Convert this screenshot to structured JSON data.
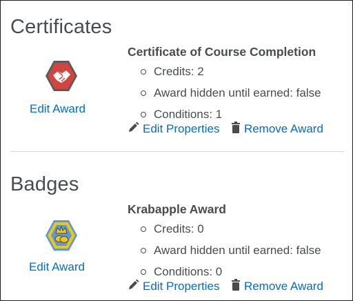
{
  "certificates": {
    "heading": "Certificates",
    "award": {
      "icon": "handshake-hexagon-icon",
      "edit_award_label": "Edit Award",
      "name": "Certificate of Course Completion",
      "properties": [
        "Credits: 2",
        "Award hidden until earned: false",
        "Conditions: 1"
      ],
      "edit_properties_label": "Edit Properties",
      "remove_award_label": "Remove Award"
    }
  },
  "badges": {
    "heading": "Badges",
    "award": {
      "icon": "crown-hexagon-icon",
      "edit_award_label": "Edit Award",
      "name": "Krabapple Award",
      "properties": [
        "Credits: 0",
        "Award hidden until earned: false",
        "Conditions: 0"
      ],
      "edit_properties_label": "Edit Properties",
      "remove_award_label": "Remove Award"
    }
  },
  "colors": {
    "link": "#006fbf",
    "text": "#494c4e",
    "certificate_badge": "#d0453f",
    "badge_gold": "#f0c419",
    "badge_blue": "#5b9bd5"
  }
}
